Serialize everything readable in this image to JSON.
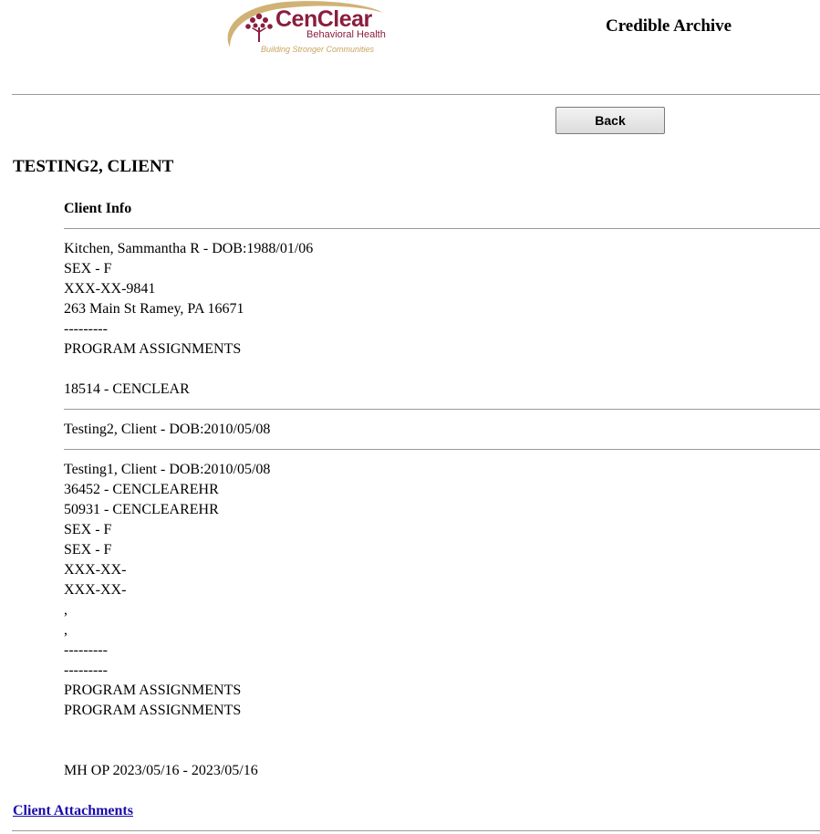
{
  "header": {
    "logo": {
      "name": "CenClear",
      "subtitle": "Behavioral Health",
      "tagline": "Building Stronger Communities"
    },
    "site_title": "Credible Archive"
  },
  "toolbar": {
    "back_label": "Back"
  },
  "client": {
    "name": "TESTING2, CLIENT"
  },
  "client_info": {
    "heading": "Client Info",
    "block1": [
      "Kitchen, Sammantha R - DOB:1988/01/06",
      "SEX - F",
      "XXX-XX-9841",
      "263 Main St Ramey, PA 16671",
      "---------",
      "PROGRAM ASSIGNMENTS",
      "",
      "18514 - CENCLEAR"
    ],
    "block2": [
      "Testing2, Client - DOB:2010/05/08"
    ],
    "block3": [
      "Testing1, Client - DOB:2010/05/08",
      "36452 - CENCLEAREHR",
      "50931 - CENCLEAREHR",
      "SEX - F",
      "SEX - F",
      "XXX-XX-",
      "XXX-XX-",
      ",",
      ",",
      "---------",
      "---------",
      "PROGRAM ASSIGNMENTS",
      "PROGRAM ASSIGNMENTS",
      "",
      "",
      "MH OP 2023/05/16 - 2023/05/16"
    ]
  },
  "footer": {
    "attachments_link": "Client Attachments"
  },
  "colors": {
    "brand": "#8b1d3e",
    "gold": "#c9a55e",
    "link": "#1a0dab"
  }
}
